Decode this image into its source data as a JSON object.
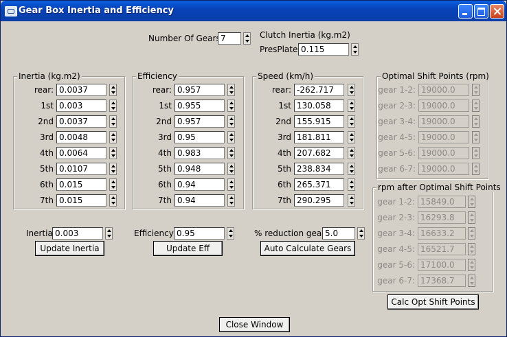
{
  "window": {
    "title": "Gear Box Inertia and Efficiency"
  },
  "top": {
    "num_gears_label": "Number Of Gears",
    "num_gears_value": "7",
    "clutch_label": "Clutch Inertia (kg.m2)",
    "presplate_label": "PresPlate",
    "presplate_value": "0.115"
  },
  "inertia": {
    "title": "Inertia (kg.m2)",
    "rows": [
      {
        "label": "rear:",
        "value": "0.0037"
      },
      {
        "label": "1st",
        "value": "0.003"
      },
      {
        "label": "2nd",
        "value": "0.0037"
      },
      {
        "label": "3rd",
        "value": "0.0048"
      },
      {
        "label": "4th",
        "value": "0.0064"
      },
      {
        "label": "5th",
        "value": "0.0107"
      },
      {
        "label": "6th",
        "value": "0.015"
      },
      {
        "label": "7th",
        "value": "0.015"
      }
    ],
    "all_label": "Inertia",
    "all_value": "0.003",
    "update_button": "Update Inertia"
  },
  "efficiency": {
    "title": "Efficiency",
    "rows": [
      {
        "label": "rear:",
        "value": "0.957"
      },
      {
        "label": "1st",
        "value": "0.955"
      },
      {
        "label": "2nd",
        "value": "0.957"
      },
      {
        "label": "3rd",
        "value": "0.95"
      },
      {
        "label": "4th",
        "value": "0.983"
      },
      {
        "label": "5th",
        "value": "0.948"
      },
      {
        "label": "6th",
        "value": "0.94"
      },
      {
        "label": "7th",
        "value": "0.94"
      }
    ],
    "all_label": "Efficiency",
    "all_value": "0.95",
    "update_button": "Update Eff"
  },
  "speed": {
    "title": "Speed (km/h)",
    "rows": [
      {
        "label": "rear:",
        "value": "-262.717"
      },
      {
        "label": "1st",
        "value": "130.058"
      },
      {
        "label": "2nd",
        "value": "155.915"
      },
      {
        "label": "3rd",
        "value": "181.811"
      },
      {
        "label": "4th",
        "value": "207.682"
      },
      {
        "label": "5th",
        "value": "238.834"
      },
      {
        "label": "6th",
        "value": "265.371"
      },
      {
        "label": "7th",
        "value": "290.295"
      }
    ],
    "reduction_label": "% reduction gear",
    "reduction_value": "5.0",
    "auto_button": "Auto Calculate Gears"
  },
  "optimal": {
    "title": "Optimal Shift Points (rpm)",
    "rows": [
      {
        "label": "gear 1-2:",
        "value": "19000.0"
      },
      {
        "label": "gear 2-3:",
        "value": "19000.0"
      },
      {
        "label": "gear 3-4:",
        "value": "19000.0"
      },
      {
        "label": "gear 4-5:",
        "value": "19000.0"
      },
      {
        "label": "gear 5-6:",
        "value": "19000.0"
      },
      {
        "label": "gear 6-7:",
        "value": "19000.0"
      }
    ]
  },
  "after": {
    "title": "rpm after Optimal Shift Points",
    "rows": [
      {
        "label": "gear 1-2:",
        "value": "15849.0"
      },
      {
        "label": "gear 2-3:",
        "value": "16293.8"
      },
      {
        "label": "gear 3-4:",
        "value": "16633.2"
      },
      {
        "label": "gear 4-5:",
        "value": "16521.7"
      },
      {
        "label": "gear 5-6:",
        "value": "17100.0"
      },
      {
        "label": "gear 6-7:",
        "value": "17368.7"
      }
    ],
    "calc_button": "Calc Opt Shift Points"
  },
  "close_button": "Close Window"
}
